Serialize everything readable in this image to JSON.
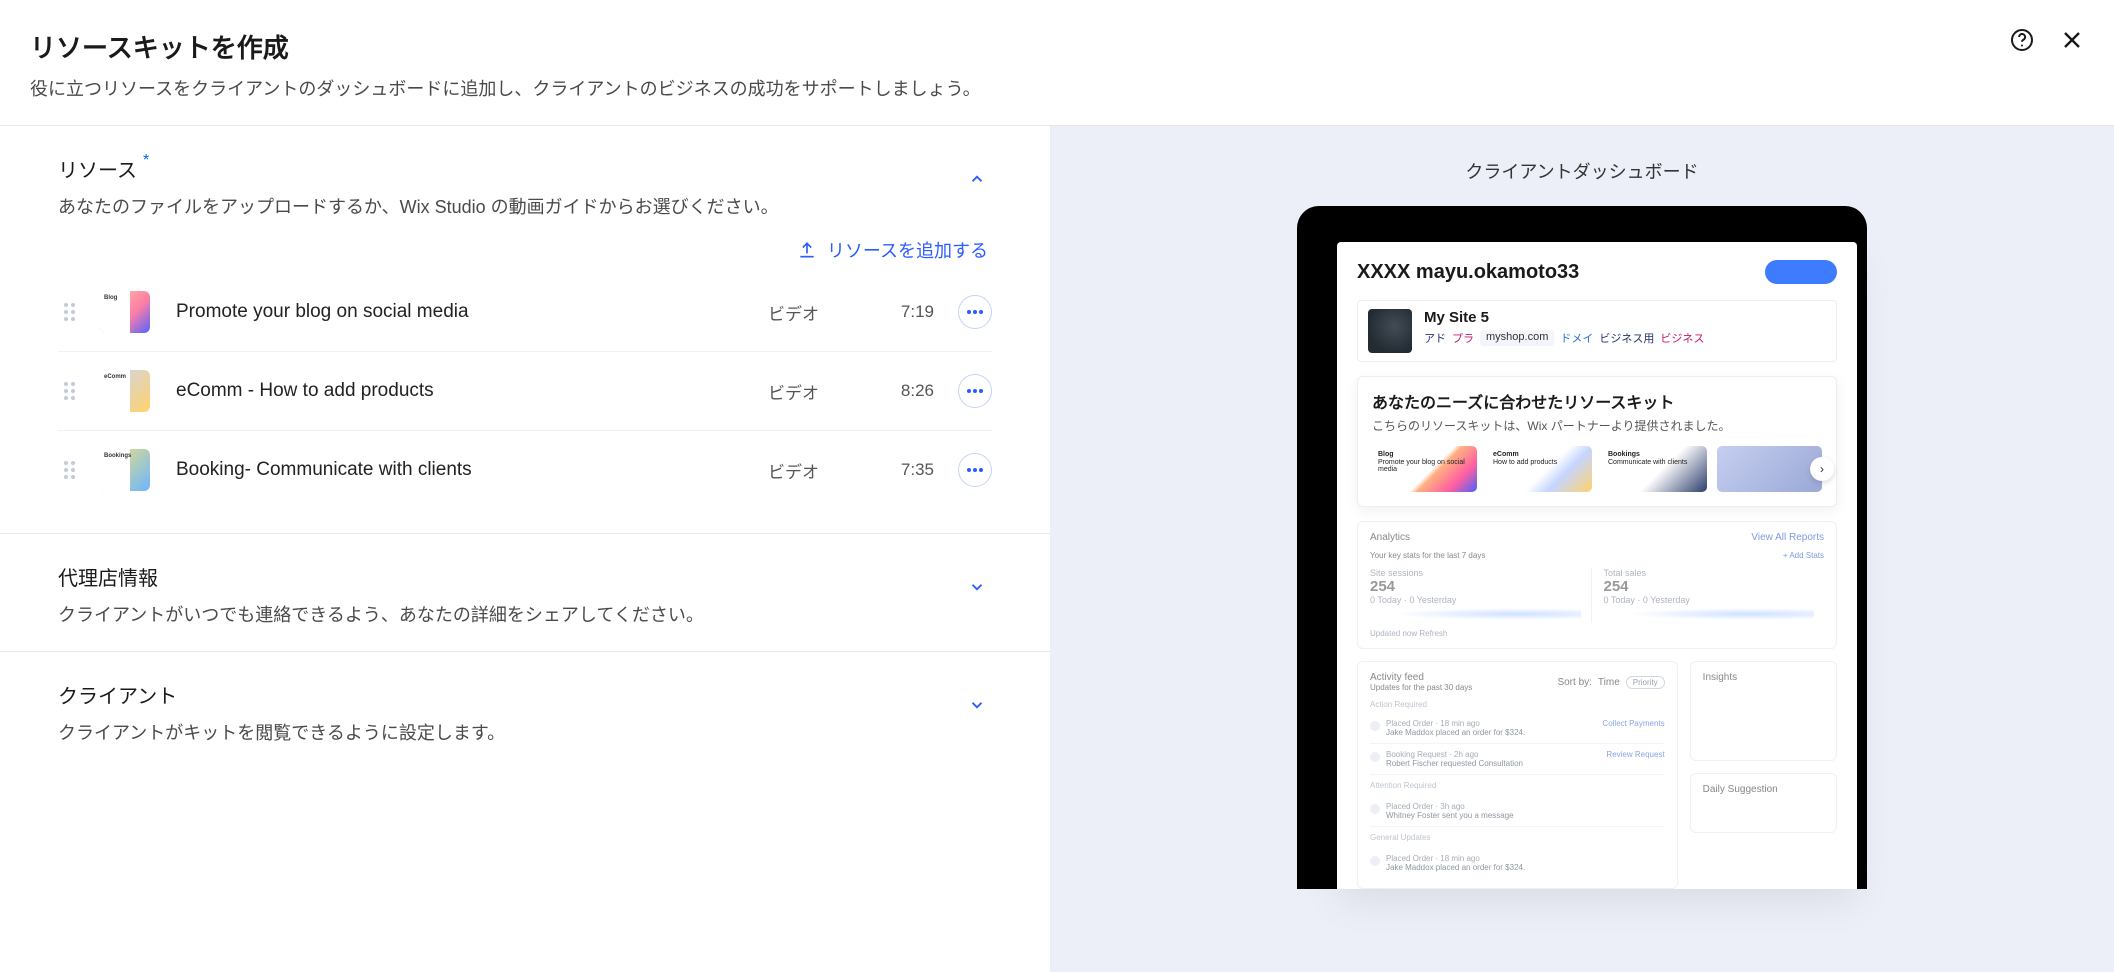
{
  "header": {
    "title": "リソースキットを作成",
    "subtitle": "役に立つリソースをクライアントのダッシュボードに追加し、クライアントのビジネスの成功をサポートしましょう。"
  },
  "sections": {
    "resources": {
      "title": "リソース",
      "required_mark": "*",
      "description": "あなたのファイルをアップロードするか、Wix Studio の動画ガイドからお選びください。",
      "add_label": "リソースを追加する",
      "items": [
        {
          "thumb_text": "Blog",
          "name": "Promote your blog on social media",
          "type": "ビデオ",
          "duration": "7:19"
        },
        {
          "thumb_text": "eComm",
          "name": "eComm - How to add products",
          "type": "ビデオ",
          "duration": "8:26"
        },
        {
          "thumb_text": "Bookings",
          "name": "Booking- Communicate with clients",
          "type": "ビデオ",
          "duration": "7:35"
        }
      ]
    },
    "agency": {
      "title": "代理店情報",
      "description": "クライアントがいつでも連絡できるよう、あなたの詳細をシェアしてください。"
    },
    "client": {
      "title": "クライアント",
      "description": "クライアントがキットを閲覧できるように設定します。"
    }
  },
  "preview": {
    "caption": "クライアントダッシュボード",
    "dash_user": "XXXX mayu.okamoto33",
    "site_name": "My Site 5",
    "chips": {
      "a": "アド",
      "b": "プラ",
      "url": "myshop.com",
      "c": "ドメイ",
      "d": "ビジネス用",
      "e": "ビジネス"
    },
    "kit": {
      "title": "あなたのニーズに合わせたリソースキット",
      "subtitle": "こちらのリソースキットは、Wix パートナーより提供されました。",
      "tiles": [
        {
          "t": "Blog",
          "s": "Promote your blog on social media"
        },
        {
          "t": "eComm",
          "s": "How to add products"
        },
        {
          "t": "Bookings",
          "s": "Communicate with clients"
        }
      ]
    },
    "analytics": {
      "title": "Analytics",
      "view_all": "View All Reports",
      "range": "Your key stats for the last 7 days",
      "add_stats": "+  Add Stats",
      "stat1_label": "Site sessions",
      "stat1_value": "254",
      "stat1_sub": "0 Today · 0 Yesterday",
      "stat2_label": "Total sales",
      "stat2_value": "254",
      "stat2_sub": "0 Today · 0 Yesterday",
      "updated": "Updated now Refresh"
    },
    "activity": {
      "title": "Activity feed",
      "sub": "Updates for the past 30 days",
      "sort": "Sort by:",
      "time": "Time",
      "priority": "Priority",
      "g1": "Action Required",
      "i1_a": "Placed Order  ·  18 min ago",
      "i1_b": "Jake Maddox placed an order for $324.",
      "i1_r": "Collect Payments",
      "i2_a": "Booking Request  ·  2h ago",
      "i2_b": "Robert Fischer requested Consultation",
      "i2_r": "Review Request",
      "g2": "Attention Required",
      "i3_a": "Placed Order  ·  3h ago",
      "i3_b": "Whitney Foster sent you a message",
      "g3": "General Updates",
      "i4_a": "Placed Order  ·  18 min ago",
      "i4_b": "Jake Maddox placed an order for $324."
    },
    "insights": "Insights",
    "daily": "Daily Suggestion"
  }
}
